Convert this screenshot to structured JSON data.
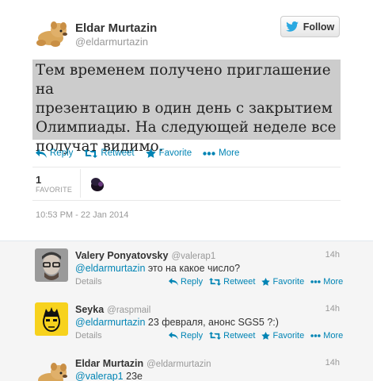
{
  "tweet": {
    "author_name": "Eldar Murtazin",
    "author_handle": "@eldarmurtazin",
    "follow_label": "Follow",
    "text_lines": [
      "Тем временем получено приглашение на",
      "презентацию в один день с закрытием",
      "Олимпиады. На следующей неделе все",
      "получат видимо."
    ],
    "actions": {
      "reply": "Reply",
      "retweet": "Retweet",
      "favorite": "Favorite",
      "more": "More"
    },
    "favorite_count": "1",
    "favorite_label": "FAVORITE",
    "timestamp": "10:53 PM - 22 Jan 2014"
  },
  "replies": [
    {
      "name": "Valery Ponyatovsky",
      "handle": "@valerap1",
      "time": "14h",
      "mention": "@eldarmurtazin",
      "text": " это на какое число?",
      "details": "Details",
      "reply": "Reply",
      "retweet": "Retweet",
      "favorite": "Favorite",
      "more": "More"
    },
    {
      "name": "Seyka",
      "handle": "@raspmail",
      "time": "14h",
      "mention": "@eldarmurtazin",
      "text": " 23 февраля, анонс SGS5 ?:)",
      "details": "Details",
      "reply": "Reply",
      "retweet": "Retweet",
      "favorite": "Favorite",
      "more": "More"
    },
    {
      "name": "Eldar Murtazin",
      "handle": "@eldarmurtazin",
      "time": "14h",
      "mention": "@valerap1",
      "text": " 23е"
    }
  ],
  "colors": {
    "link": "#0084b4",
    "favorite_star": "#0084b4",
    "highlight_bg": "#cccccc"
  },
  "icons": [
    "bird-icon",
    "reply-icon",
    "retweet-icon",
    "star-icon",
    "more-dots-icon"
  ]
}
